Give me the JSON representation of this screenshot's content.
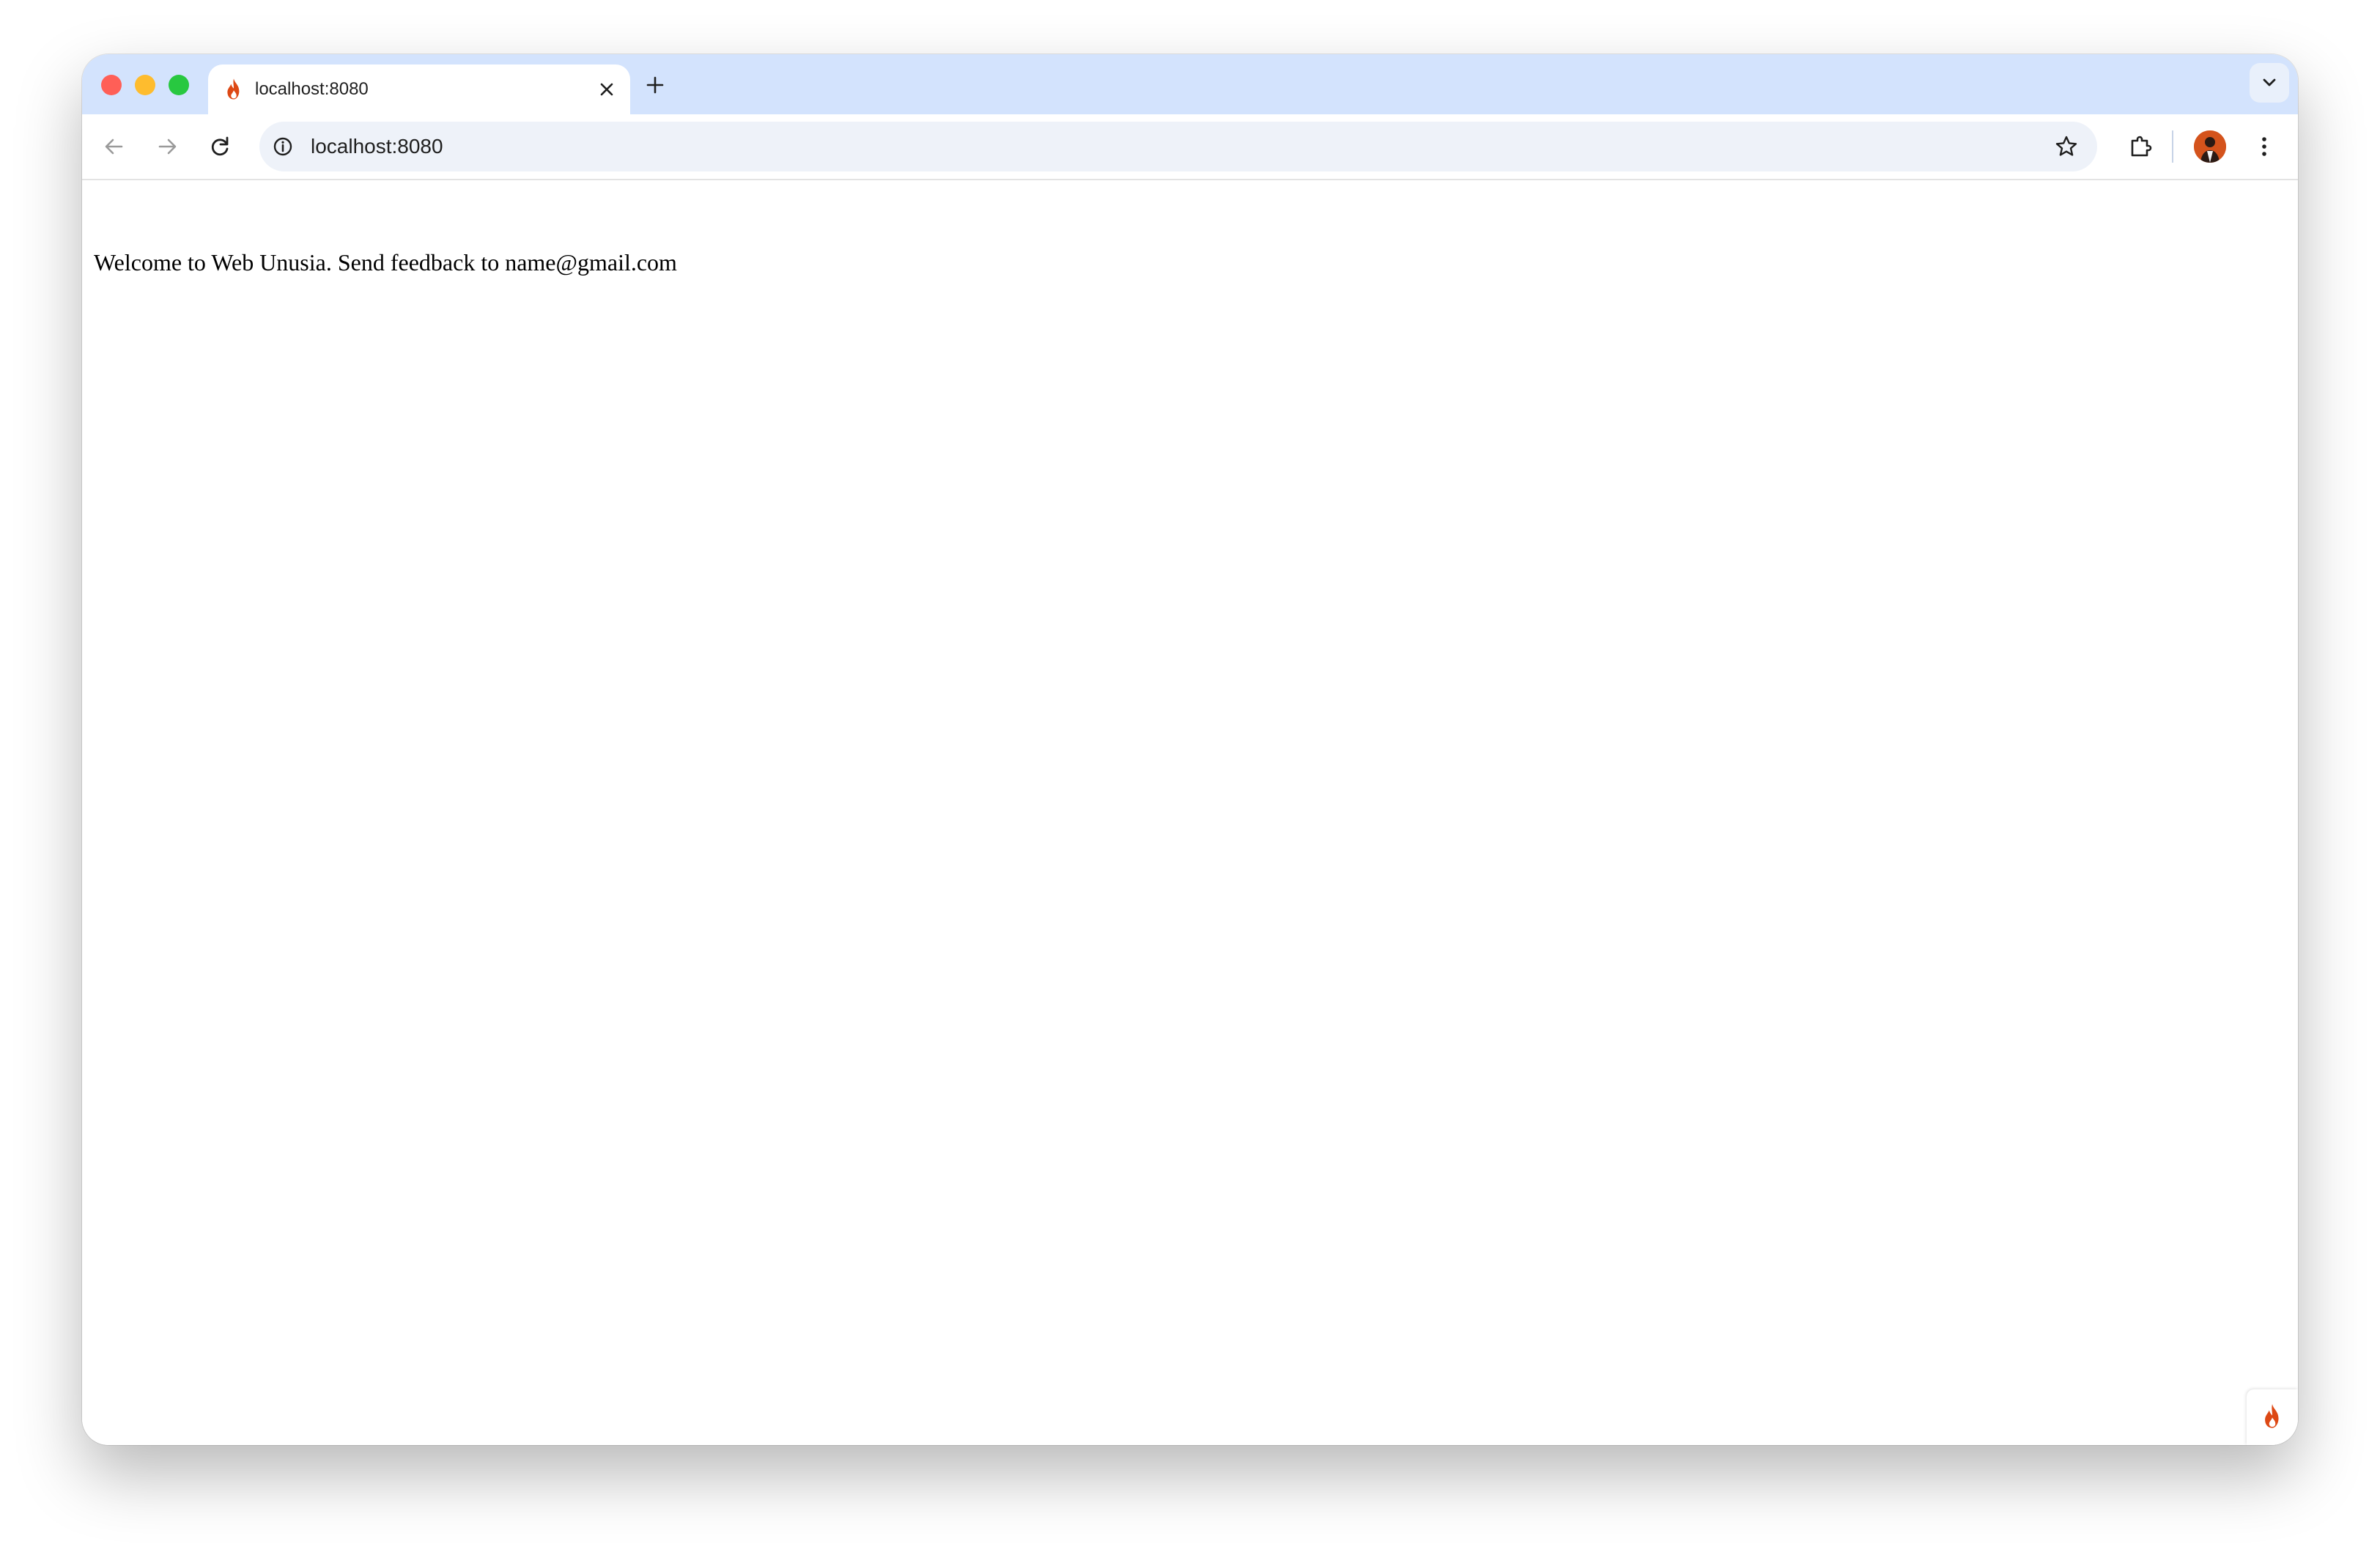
{
  "browser": {
    "tab": {
      "title": "localhost:8080",
      "favicon": "codeigniter-flame-icon"
    },
    "address_bar": {
      "url": "localhost:8080"
    },
    "icons": {
      "back": "arrow-left-icon",
      "forward": "arrow-right-icon",
      "reload": "reload-icon",
      "site_info": "info-icon",
      "bookmark": "star-icon",
      "extensions": "puzzle-icon",
      "menu": "kebab-menu-icon",
      "tab_search": "chevron-down-icon"
    },
    "colors": {
      "tabstrip": "#d3e3fd",
      "omnibox": "#eef2f9",
      "flame": "#dd4814"
    }
  },
  "page": {
    "welcome_text": "Welcome to Web Unusia. Send feedback to name@gmail.com"
  }
}
